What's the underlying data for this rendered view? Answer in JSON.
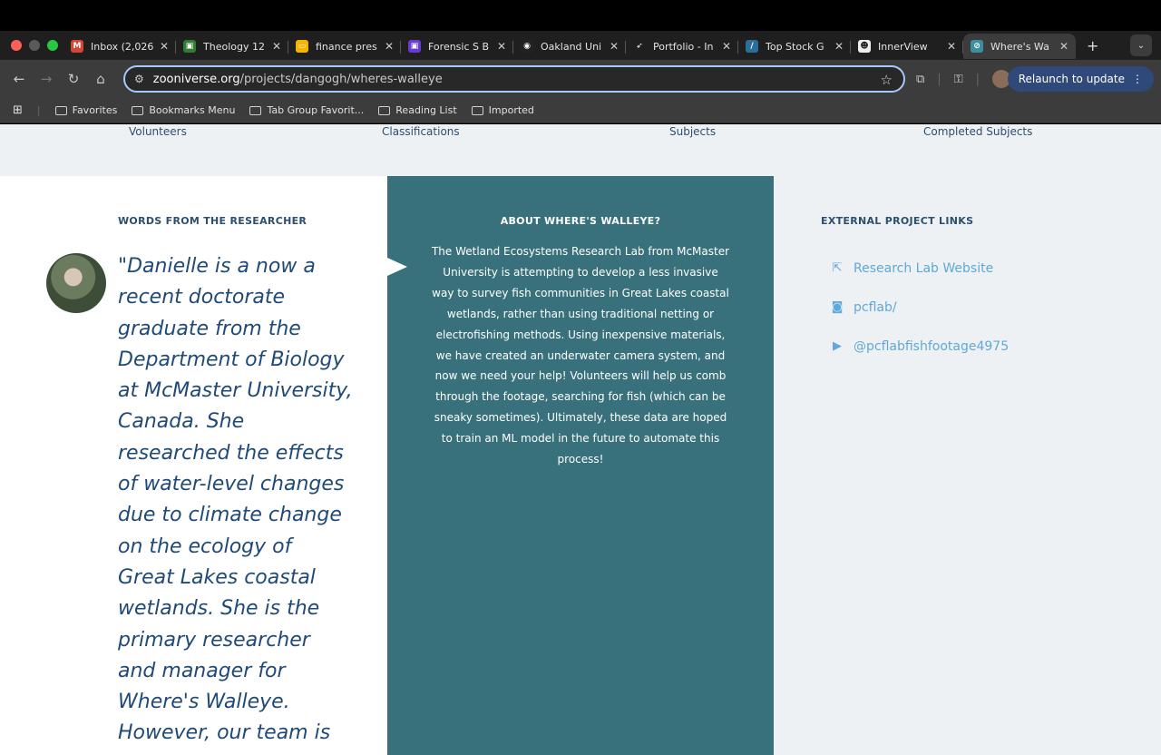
{
  "browser": {
    "tabs": [
      {
        "title": "Inbox (2,026",
        "icon": "gmail-icon",
        "color": "#d44638",
        "glyph": "M"
      },
      {
        "title": "Theology 12",
        "icon": "classroom-icon",
        "color": "#2e7d32",
        "glyph": "▣"
      },
      {
        "title": "finance pres",
        "icon": "slides-icon",
        "color": "#f4b400",
        "glyph": "▭"
      },
      {
        "title": "Forensic S B",
        "icon": "app-icon",
        "color": "#6a3bd1",
        "glyph": "▣"
      },
      {
        "title": "Oakland Uni",
        "icon": "school-icon",
        "color": "#222222",
        "glyph": "◉"
      },
      {
        "title": "Portfolio - In",
        "icon": "portfolio-icon",
        "color": "#1f1f1f",
        "glyph": "➶"
      },
      {
        "title": "Top Stock G",
        "icon": "stock-icon",
        "color": "#2a6e9a",
        "glyph": "/"
      },
      {
        "title": "InnerView",
        "icon": "innerview-icon",
        "color": "#eeeeee",
        "glyph": "☻"
      },
      {
        "title": "Where's Wa",
        "icon": "zooniverse-icon",
        "color": "#3d8fa0",
        "glyph": "⊘"
      }
    ],
    "url_domain": "zooniverse.org",
    "url_path": "/projects/dangogh/wheres-walleye",
    "relaunch_label": "Relaunch to update",
    "bookmarks": [
      "Favorites",
      "Bookmarks Menu",
      "Tab Group Favorit...",
      "Reading List",
      "Imported"
    ]
  },
  "stats": {
    "volunteers": "Volunteers",
    "classifications": "Classifications",
    "subjects": "Subjects",
    "completed": "Completed Subjects"
  },
  "researcher": {
    "heading": "WORDS FROM THE RESEARCHER",
    "quote": "\"Danielle is a now a recent doctorate graduate from the Department of Biology at McMaster University, Canada. She researched the effects of water-level changes due to climate change on the ecology of Great Lakes coastal wetlands. She is the primary researcher and manager for Where's Walleye. However, our team is growing so"
  },
  "about": {
    "heading": "ABOUT WHERE'S WALLEYE?",
    "text": "The Wetland Ecosystems Research Lab from McMaster University is attempting to develop a less invasive way to survey fish communities in Great Lakes coastal wetlands, rather than using traditional netting or electrofishing methods. Using inexpensive materials, we have created an underwater camera system, and now we need your help! Volunteers will help us comb through the footage, searching for fish (which can be sneaky sometimes). Ultimately, these data are hoped to train an ML model in the future to automate this process!"
  },
  "external": {
    "heading": "EXTERNAL PROJECT LINKS",
    "links": [
      {
        "label": "Research Lab Website",
        "icon": "external-link-icon"
      },
      {
        "label": "pcflab/",
        "icon": "instagram-icon"
      },
      {
        "label": "@pcflabfishfootage4975",
        "icon": "youtube-icon"
      }
    ]
  },
  "colors": {
    "accent_teal": "#38717c",
    "link_blue": "#5fa8d8",
    "heading_navy": "#2c4e6f"
  }
}
